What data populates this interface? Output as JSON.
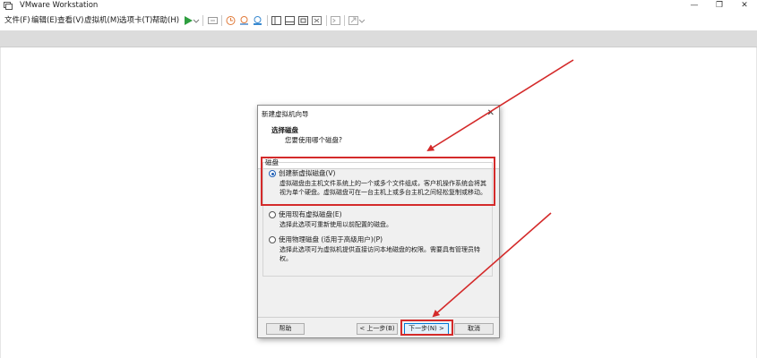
{
  "window": {
    "title": "VMware Workstation",
    "controls": {
      "minimize": "—",
      "maximize": "❐",
      "close": "✕"
    }
  },
  "menu": {
    "items": [
      "文件(F)",
      "编辑(E)",
      "查看(V)",
      "虚拟机(M)",
      "选项卡(T)",
      "帮助(H)"
    ]
  },
  "toolbar": {
    "icons": [
      "play-icon",
      "dropdown-icon",
      "send-keys-icon",
      "snapshot-icon",
      "revert-snapshot-icon",
      "snapshot-manager-icon",
      "sidebar-icon",
      "thumbnail-icon",
      "fullscreen-icon",
      "unity-icon",
      "console-icon",
      "stretch-icon"
    ],
    "accent": "#2e9e3f"
  },
  "dialog": {
    "title": "新建虚拟机向导",
    "header_title": "选择磁盘",
    "header_subtitle": "您要使用哪个磁盘?",
    "group_label": "磁盘",
    "options": [
      {
        "label": "创建新虚拟磁盘(V)",
        "desc_line1": "虚拟磁盘由主机文件系统上的一个或多个文件组成，客户机操作系统会将其",
        "desc_line2": "视为单个硬盘。虚拟磁盘可在一台主机上或多台主机之间轻松复制或移动。",
        "selected": true
      },
      {
        "label": "使用现有虚拟磁盘(E)",
        "desc_line1": "选择此选项可重新使用以前配置的磁盘。",
        "selected": false
      },
      {
        "label": "使用物理磁盘 (适用于高级用户)(P)",
        "desc_line1": "选择此选项可为虚拟机提供直接访问本地磁盘的权限。需要具有管理员特",
        "desc_line2": "权。",
        "selected": false
      }
    ],
    "buttons": {
      "help": "帮助",
      "back": "< 上一步(B)",
      "next": "下一步(N) >",
      "cancel": "取消"
    }
  },
  "colors": {
    "highlight": "#d42a2a",
    "band": "#dcdcdc",
    "dialog_bg": "#f0f0f0"
  }
}
